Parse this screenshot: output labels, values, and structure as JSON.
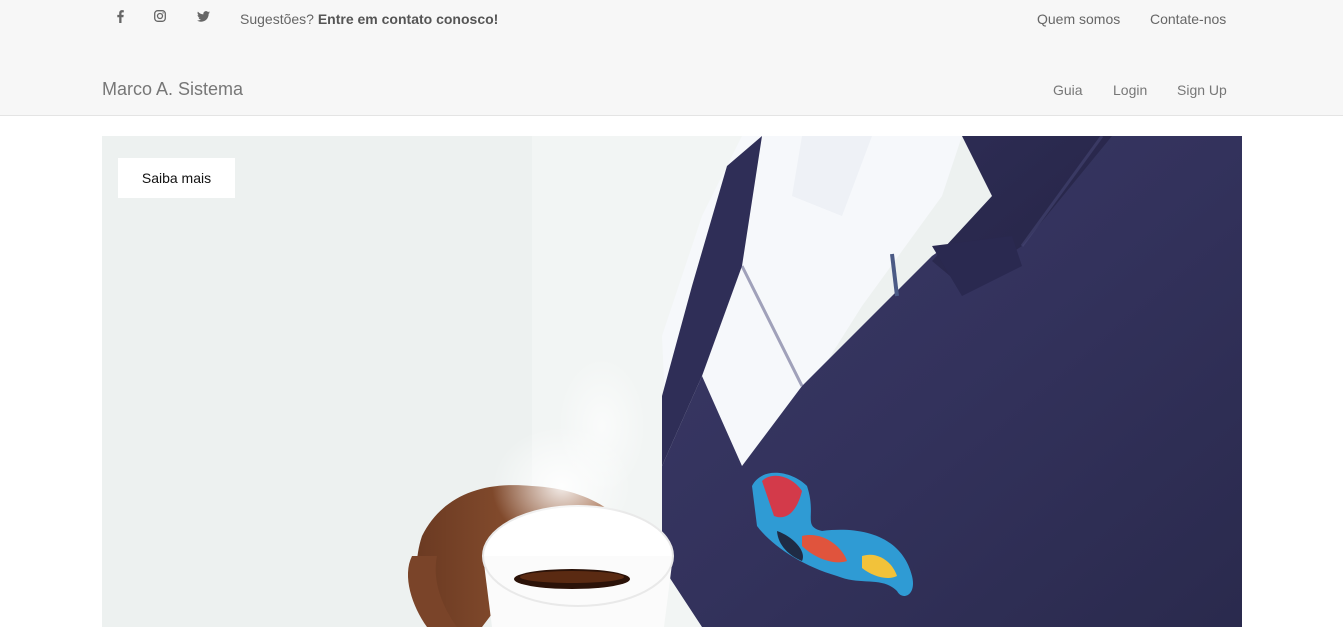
{
  "topbar": {
    "social_icons": [
      {
        "name": "facebook-icon",
        "glyph": "f"
      },
      {
        "name": "instagram-icon",
        "glyph": "instagram"
      },
      {
        "name": "twitter-icon",
        "glyph": "twitter"
      }
    ],
    "suggestion_prefix": "Sugestões?",
    "suggestion_link": "Entre em contato conosco!",
    "links": [
      "Quem somos",
      "Contate-nos"
    ]
  },
  "navbar": {
    "brand": "Marco A. Sistema",
    "links": [
      "Guia",
      "Login",
      "Sign Up"
    ]
  },
  "hero": {
    "button_label": "Saiba mais",
    "image_subject": "man in navy suit jacket with colorful pocket square holding a white coffee cup"
  },
  "colors": {
    "topbar_bg": "#f7f7f7",
    "text_muted": "#666666",
    "suit_navy": "#33325c",
    "background": "#ffffff"
  }
}
